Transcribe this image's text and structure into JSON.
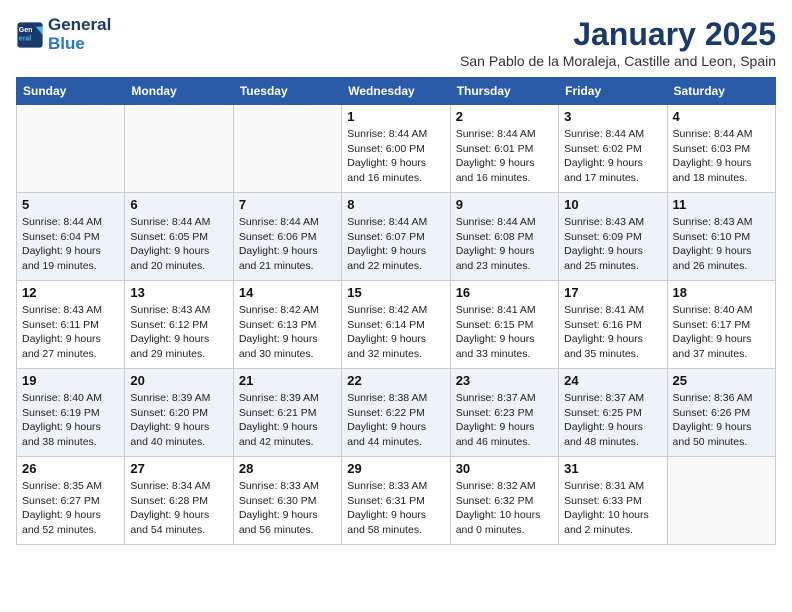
{
  "header": {
    "logo_line1": "General",
    "logo_line2": "Blue",
    "month_title": "January 2025",
    "subtitle": "San Pablo de la Moraleja, Castille and Leon, Spain"
  },
  "weekdays": [
    "Sunday",
    "Monday",
    "Tuesday",
    "Wednesday",
    "Thursday",
    "Friday",
    "Saturday"
  ],
  "weeks": [
    [
      {
        "day": "",
        "sunrise": "",
        "sunset": "",
        "daylight": ""
      },
      {
        "day": "",
        "sunrise": "",
        "sunset": "",
        "daylight": ""
      },
      {
        "day": "",
        "sunrise": "",
        "sunset": "",
        "daylight": ""
      },
      {
        "day": "1",
        "sunrise": "Sunrise: 8:44 AM",
        "sunset": "Sunset: 6:00 PM",
        "daylight": "Daylight: 9 hours and 16 minutes."
      },
      {
        "day": "2",
        "sunrise": "Sunrise: 8:44 AM",
        "sunset": "Sunset: 6:01 PM",
        "daylight": "Daylight: 9 hours and 16 minutes."
      },
      {
        "day": "3",
        "sunrise": "Sunrise: 8:44 AM",
        "sunset": "Sunset: 6:02 PM",
        "daylight": "Daylight: 9 hours and 17 minutes."
      },
      {
        "day": "4",
        "sunrise": "Sunrise: 8:44 AM",
        "sunset": "Sunset: 6:03 PM",
        "daylight": "Daylight: 9 hours and 18 minutes."
      }
    ],
    [
      {
        "day": "5",
        "sunrise": "Sunrise: 8:44 AM",
        "sunset": "Sunset: 6:04 PM",
        "daylight": "Daylight: 9 hours and 19 minutes."
      },
      {
        "day": "6",
        "sunrise": "Sunrise: 8:44 AM",
        "sunset": "Sunset: 6:05 PM",
        "daylight": "Daylight: 9 hours and 20 minutes."
      },
      {
        "day": "7",
        "sunrise": "Sunrise: 8:44 AM",
        "sunset": "Sunset: 6:06 PM",
        "daylight": "Daylight: 9 hours and 21 minutes."
      },
      {
        "day": "8",
        "sunrise": "Sunrise: 8:44 AM",
        "sunset": "Sunset: 6:07 PM",
        "daylight": "Daylight: 9 hours and 22 minutes."
      },
      {
        "day": "9",
        "sunrise": "Sunrise: 8:44 AM",
        "sunset": "Sunset: 6:08 PM",
        "daylight": "Daylight: 9 hours and 23 minutes."
      },
      {
        "day": "10",
        "sunrise": "Sunrise: 8:43 AM",
        "sunset": "Sunset: 6:09 PM",
        "daylight": "Daylight: 9 hours and 25 minutes."
      },
      {
        "day": "11",
        "sunrise": "Sunrise: 8:43 AM",
        "sunset": "Sunset: 6:10 PM",
        "daylight": "Daylight: 9 hours and 26 minutes."
      }
    ],
    [
      {
        "day": "12",
        "sunrise": "Sunrise: 8:43 AM",
        "sunset": "Sunset: 6:11 PM",
        "daylight": "Daylight: 9 hours and 27 minutes."
      },
      {
        "day": "13",
        "sunrise": "Sunrise: 8:43 AM",
        "sunset": "Sunset: 6:12 PM",
        "daylight": "Daylight: 9 hours and 29 minutes."
      },
      {
        "day": "14",
        "sunrise": "Sunrise: 8:42 AM",
        "sunset": "Sunset: 6:13 PM",
        "daylight": "Daylight: 9 hours and 30 minutes."
      },
      {
        "day": "15",
        "sunrise": "Sunrise: 8:42 AM",
        "sunset": "Sunset: 6:14 PM",
        "daylight": "Daylight: 9 hours and 32 minutes."
      },
      {
        "day": "16",
        "sunrise": "Sunrise: 8:41 AM",
        "sunset": "Sunset: 6:15 PM",
        "daylight": "Daylight: 9 hours and 33 minutes."
      },
      {
        "day": "17",
        "sunrise": "Sunrise: 8:41 AM",
        "sunset": "Sunset: 6:16 PM",
        "daylight": "Daylight: 9 hours and 35 minutes."
      },
      {
        "day": "18",
        "sunrise": "Sunrise: 8:40 AM",
        "sunset": "Sunset: 6:17 PM",
        "daylight": "Daylight: 9 hours and 37 minutes."
      }
    ],
    [
      {
        "day": "19",
        "sunrise": "Sunrise: 8:40 AM",
        "sunset": "Sunset: 6:19 PM",
        "daylight": "Daylight: 9 hours and 38 minutes."
      },
      {
        "day": "20",
        "sunrise": "Sunrise: 8:39 AM",
        "sunset": "Sunset: 6:20 PM",
        "daylight": "Daylight: 9 hours and 40 minutes."
      },
      {
        "day": "21",
        "sunrise": "Sunrise: 8:39 AM",
        "sunset": "Sunset: 6:21 PM",
        "daylight": "Daylight: 9 hours and 42 minutes."
      },
      {
        "day": "22",
        "sunrise": "Sunrise: 8:38 AM",
        "sunset": "Sunset: 6:22 PM",
        "daylight": "Daylight: 9 hours and 44 minutes."
      },
      {
        "day": "23",
        "sunrise": "Sunrise: 8:37 AM",
        "sunset": "Sunset: 6:23 PM",
        "daylight": "Daylight: 9 hours and 46 minutes."
      },
      {
        "day": "24",
        "sunrise": "Sunrise: 8:37 AM",
        "sunset": "Sunset: 6:25 PM",
        "daylight": "Daylight: 9 hours and 48 minutes."
      },
      {
        "day": "25",
        "sunrise": "Sunrise: 8:36 AM",
        "sunset": "Sunset: 6:26 PM",
        "daylight": "Daylight: 9 hours and 50 minutes."
      }
    ],
    [
      {
        "day": "26",
        "sunrise": "Sunrise: 8:35 AM",
        "sunset": "Sunset: 6:27 PM",
        "daylight": "Daylight: 9 hours and 52 minutes."
      },
      {
        "day": "27",
        "sunrise": "Sunrise: 8:34 AM",
        "sunset": "Sunset: 6:28 PM",
        "daylight": "Daylight: 9 hours and 54 minutes."
      },
      {
        "day": "28",
        "sunrise": "Sunrise: 8:33 AM",
        "sunset": "Sunset: 6:30 PM",
        "daylight": "Daylight: 9 hours and 56 minutes."
      },
      {
        "day": "29",
        "sunrise": "Sunrise: 8:33 AM",
        "sunset": "Sunset: 6:31 PM",
        "daylight": "Daylight: 9 hours and 58 minutes."
      },
      {
        "day": "30",
        "sunrise": "Sunrise: 8:32 AM",
        "sunset": "Sunset: 6:32 PM",
        "daylight": "Daylight: 10 hours and 0 minutes."
      },
      {
        "day": "31",
        "sunrise": "Sunrise: 8:31 AM",
        "sunset": "Sunset: 6:33 PM",
        "daylight": "Daylight: 10 hours and 2 minutes."
      },
      {
        "day": "",
        "sunrise": "",
        "sunset": "",
        "daylight": ""
      }
    ]
  ]
}
